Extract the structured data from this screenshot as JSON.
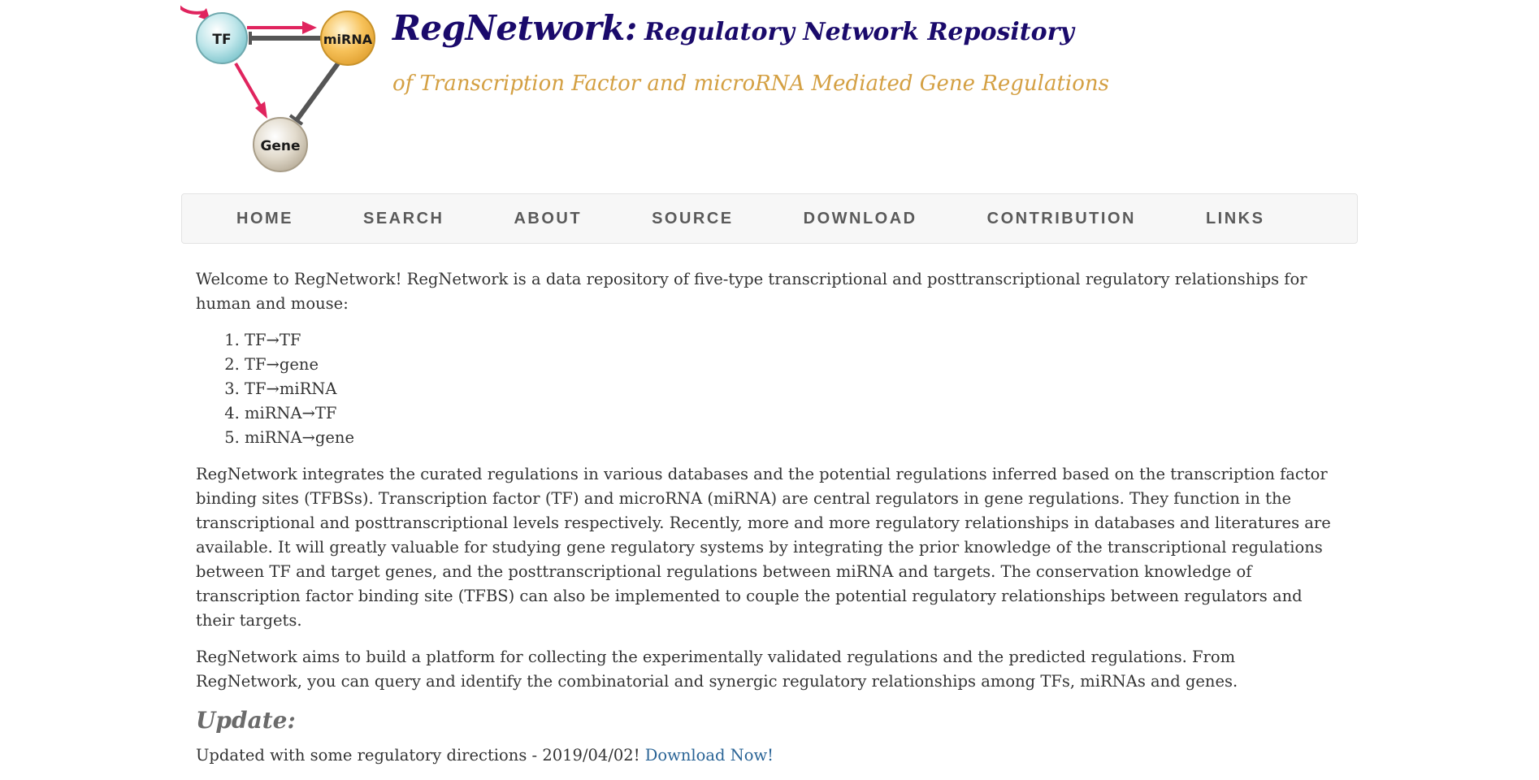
{
  "header": {
    "logo_nodes": {
      "tf": "TF",
      "mirna": "miRNA",
      "gene": "Gene"
    },
    "title_main": "RegNetwork:",
    "title_sub": "Regulatory Network Repository",
    "tagline": "of Transcription Factor and microRNA Mediated Gene Regulations",
    "colors": {
      "title": "#1a0a6b",
      "tagline": "#d4a043",
      "arrow": "#e0245e",
      "inhibit": "#555555"
    }
  },
  "nav": {
    "items": [
      "HOME",
      "SEARCH",
      "ABOUT",
      "SOURCE",
      "DOWNLOAD",
      "CONTRIBUTION",
      "LINKS"
    ]
  },
  "main": {
    "intro": "Welcome to RegNetwork! RegNetwork is a data repository of five-type transcriptional and posttranscriptional regulatory relationships for human and mouse:",
    "list": [
      "TF→TF",
      "TF→gene",
      "TF→miRNA",
      "miRNA→TF",
      "miRNA→gene"
    ],
    "paragraph2": "RegNetwork integrates the curated regulations in various databases and the potential regulations inferred based on the transcription factor binding sites (TFBSs). Transcription factor (TF) and microRNA (miRNA) are central regulators in gene regulations. They function in the transcriptional and posttranscriptional levels respectively. Recently, more and more regulatory relationships in databases and literatures are available. It will greatly valuable for studying gene regulatory systems by integrating the prior knowledge of the transcriptional regulations between TF and target genes, and the posttranscriptional regulations between miRNA and targets. The conservation knowledge of transcription factor binding site (TFBS) can also be implemented to couple the potential regulatory relationships between regulators and their targets.",
    "paragraph3": "RegNetwork aims to build a platform for collecting the experimentally validated regulations and the predicted regulations. From RegNetwork, you can query and identify the combinatorial and synergic regulatory relationships among TFs, miRNAs and genes.",
    "update_heading": "Update:",
    "update_text": "Updated with some regulatory directions - 2019/04/02!",
    "update_link": "Download Now!",
    "colors": {
      "link": "#2a6496",
      "heading": "#6b6b6b"
    }
  }
}
